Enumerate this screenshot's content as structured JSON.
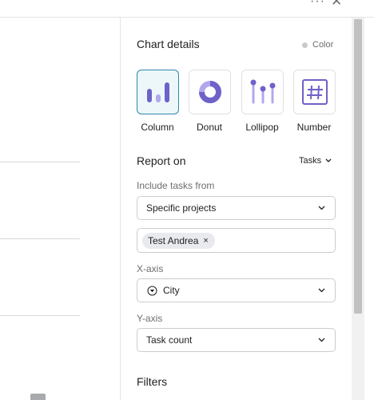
{
  "topbar": {
    "more_icon_glyph": "···",
    "close_icon_glyph": "✕"
  },
  "panel": {
    "title": "Chart details",
    "color_toggle_label": "Color",
    "chart_types": [
      {
        "label": "Column",
        "icon": "column-chart-icon",
        "selected": true
      },
      {
        "label": "Donut",
        "icon": "donut-chart-icon",
        "selected": false
      },
      {
        "label": "Lollipop",
        "icon": "lollipop-chart-icon",
        "selected": false
      },
      {
        "label": "Number",
        "icon": "number-chart-icon",
        "selected": false
      }
    ],
    "report_on": {
      "label": "Report on",
      "value": "Tasks"
    },
    "include_tasks": {
      "label": "Include tasks from",
      "value": "Specific projects"
    },
    "projects_token": {
      "label": "Test Andrea",
      "remove_glyph": "×"
    },
    "x_axis": {
      "label": "X-axis",
      "value": "City"
    },
    "y_axis": {
      "label": "Y-axis",
      "value": "Task count"
    },
    "filters": {
      "label": "Filters"
    }
  },
  "colors": {
    "accent": "#2e87a5",
    "chart_icon_purple": "#6e62c8",
    "chart_icon_light_purple": "#b1a8ec",
    "selected_bg": "#edf7fa"
  }
}
